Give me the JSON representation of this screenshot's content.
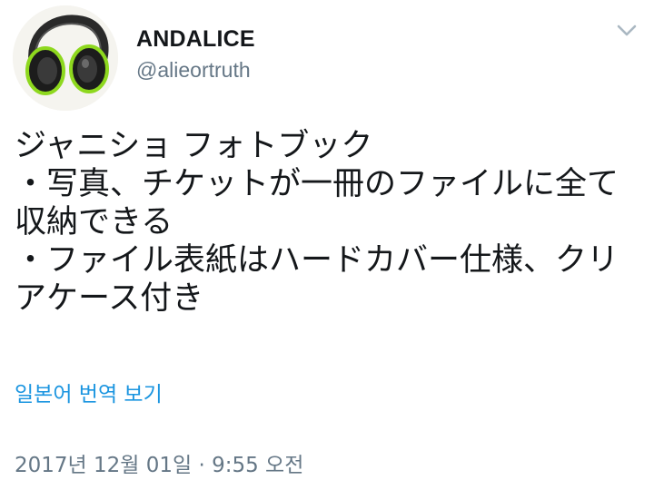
{
  "tweet": {
    "avatar": {
      "icon": "headphones-avatar",
      "accent_color": "#8ed81e"
    },
    "author": {
      "display_name": "ANDALICE",
      "handle": "@alieortruth"
    },
    "menu_icon": "chevron-down-icon",
    "text_lines": [
      "ジャニショ フォトブック",
      "・写真、チケットが一冊のファイルに全て",
      "収納できる",
      "・ファイル表紙はハードカバー仕様、クリ",
      "アケース付き"
    ],
    "translate_label": "일본어 번역 보기",
    "timestamp": "2017년 12월 01일 · 9:55 오전",
    "colors": {
      "text": "#14171a",
      "secondary": "#657786",
      "link": "#1b95e0"
    }
  }
}
